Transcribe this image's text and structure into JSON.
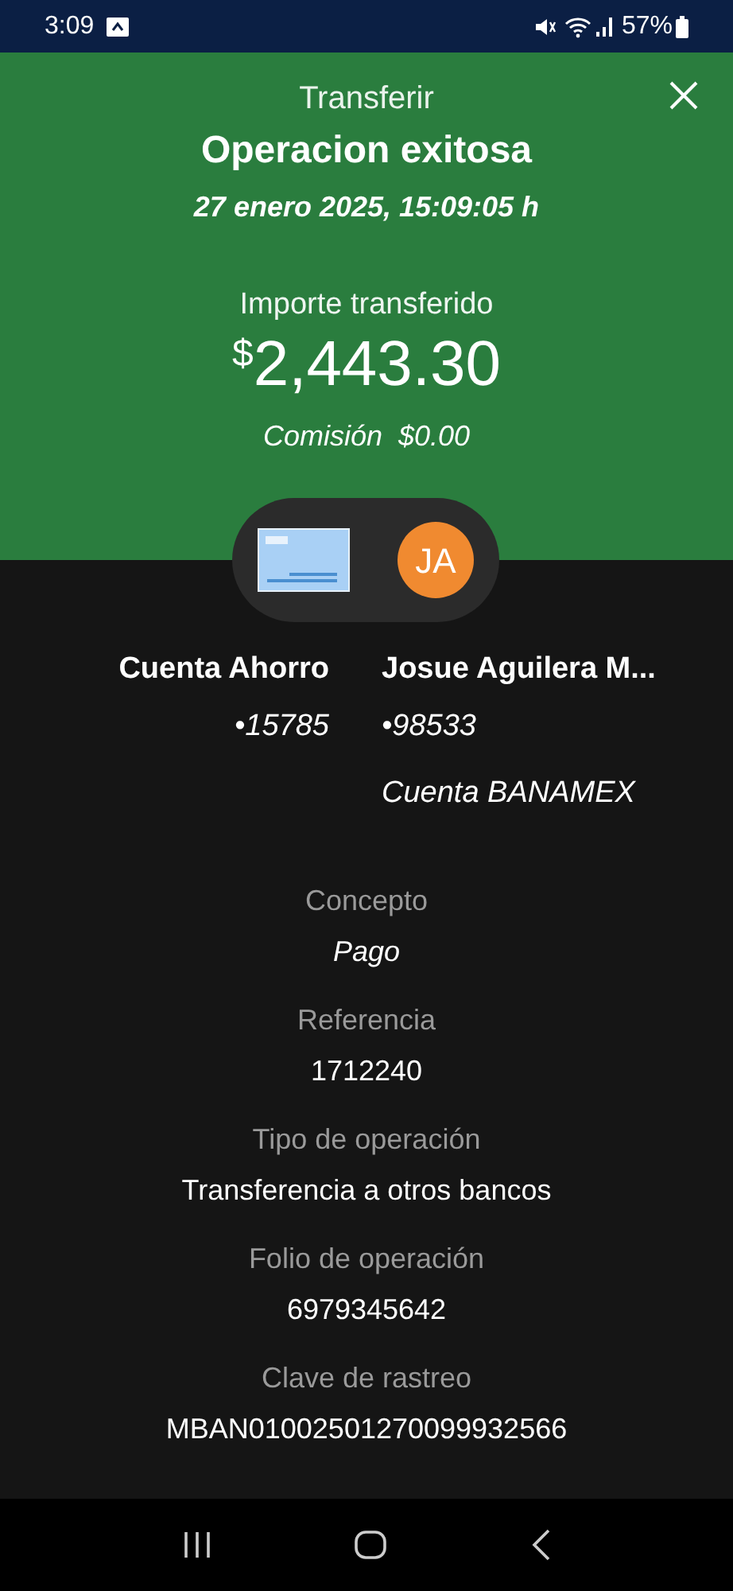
{
  "status_bar": {
    "time": "3:09",
    "battery": "57%"
  },
  "header": {
    "title": "Transferir"
  },
  "result": {
    "heading": "Operacion exitosa",
    "datetime": "27 enero 2025, 15:09:05 h",
    "amount_label": "Importe transferido",
    "currency_symbol": "$",
    "amount": "2,443.30",
    "fee_label": "Comisión",
    "fee": "$0.00"
  },
  "origin": {
    "name": "Cuenta Ahorro",
    "account": "•15785"
  },
  "destination": {
    "initials": "JA",
    "name": "Josue Aguilera M...",
    "account": "•98533",
    "bank": "Cuenta BANAMEX"
  },
  "details": [
    {
      "label": "Concepto",
      "value": "Pago",
      "italic": true
    },
    {
      "label": "Referencia",
      "value": "1712240",
      "italic": false
    },
    {
      "label": "Tipo de operación",
      "value": "Transferencia a otros bancos",
      "italic": false
    },
    {
      "label": "Folio de operación",
      "value": "6979345642",
      "italic": false
    },
    {
      "label": "Clave de rastreo",
      "value": "MBAN01002501270099932566",
      "italic": false
    }
  ]
}
